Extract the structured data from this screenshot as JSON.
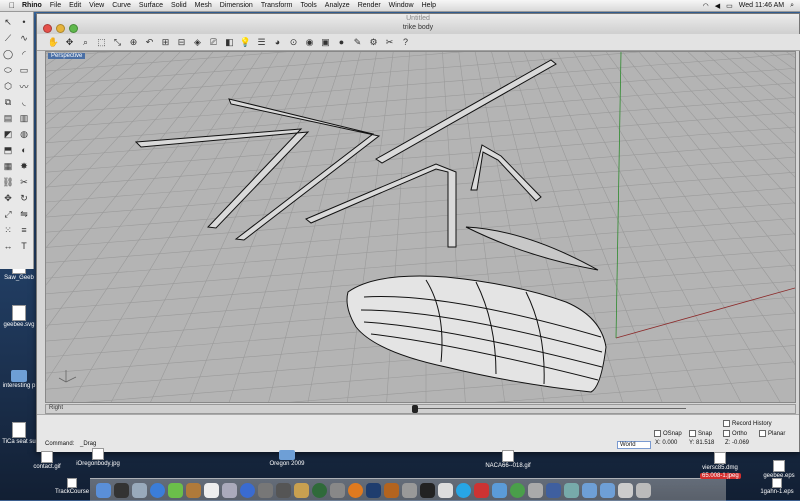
{
  "menubar": {
    "app": "Rhino",
    "items": [
      "File",
      "Edit",
      "View",
      "Curve",
      "Surface",
      "Solid",
      "Mesh",
      "Dimension",
      "Transform",
      "Tools",
      "Analyze",
      "Render",
      "Window",
      "Help"
    ],
    "clock": "Wed 11:46 AM"
  },
  "window": {
    "title": "Untitled",
    "document": "trike body"
  },
  "viewport": {
    "name": "Perspective",
    "grid_color": "#8a8a8a",
    "background": "#b4b4b4"
  },
  "scroll": {
    "label": "Right"
  },
  "panel": {
    "command_label": "Command:",
    "command_value": "_Drag",
    "osnap": "OSnap",
    "snap": "Snap",
    "ortho": "Ortho",
    "planar": "Planar",
    "record_history": "Record History",
    "world": "World",
    "x": "X: 0.000",
    "y": "Y: 81.518",
    "z": "Z: -0.069"
  },
  "desktop": {
    "icons": [
      {
        "label": "Saw_Geeb"
      },
      {
        "label": "geebee.svg"
      },
      {
        "label": "interesting p"
      },
      {
        "label": "TiCa seat su"
      },
      {
        "label": "contact.gif"
      },
      {
        "label": "iOregonbody.jpg"
      },
      {
        "label": "Oregon 2009"
      },
      {
        "label": "NACA66--018.gif"
      },
      {
        "label": "viersc85.dmg"
      },
      {
        "label": "geebee.eps"
      },
      {
        "label": "TrackCourse"
      },
      {
        "label": "1gahn-1.eps"
      }
    ],
    "dock_tag": "65.008-1.jpeg"
  }
}
